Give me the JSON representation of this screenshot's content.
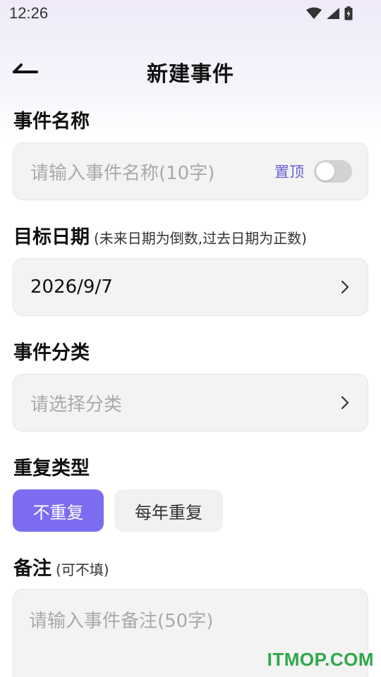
{
  "status_bar": {
    "time": "12:26",
    "icons": [
      "wifi-icon",
      "signal-icon",
      "battery-icon"
    ]
  },
  "app_bar": {
    "back_icon": "back-arrow-icon",
    "title": "新建事件"
  },
  "event_name": {
    "label": "事件名称",
    "placeholder": "请输入事件名称(10字)",
    "pin_label": "置顶",
    "pin_on": false
  },
  "target_date": {
    "label": "目标日期",
    "hint": "(未来日期为倒数,过去日期为正数)",
    "value": "2026/9/7"
  },
  "category": {
    "label": "事件分类",
    "placeholder": "请选择分类"
  },
  "repeat": {
    "label": "重复类型",
    "options": [
      "不重复",
      "每年重复"
    ],
    "selected": "不重复"
  },
  "notes": {
    "label": "备注",
    "hint": "(可不填)",
    "placeholder": "请输入事件备注(50字)"
  },
  "watermark": "ITMOP.COM",
  "colors": {
    "accent": "#7b6cf0",
    "pin_text": "#6a5fd4",
    "field_bg": "#f3f3f3",
    "placeholder": "#a9a9a9"
  }
}
